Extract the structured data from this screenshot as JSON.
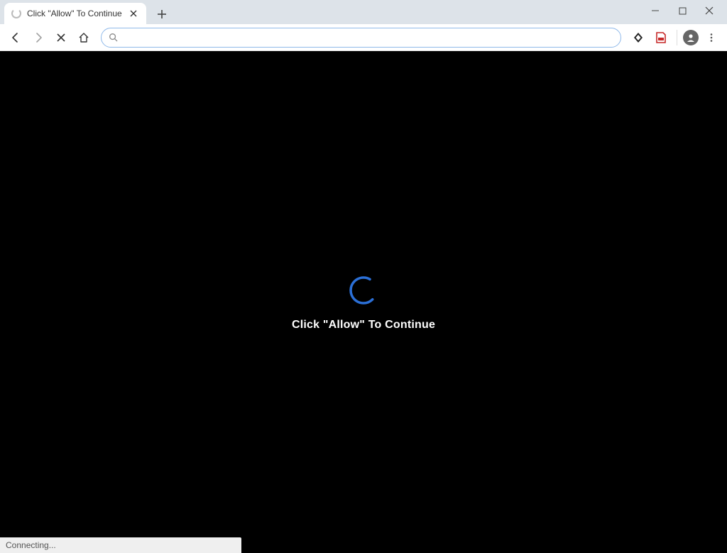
{
  "tab": {
    "title": "Click \"Allow\" To Continue"
  },
  "address_bar": {
    "value": ""
  },
  "page": {
    "message": "Click \"Allow\" To Continue"
  },
  "status": {
    "text": "Connecting..."
  }
}
